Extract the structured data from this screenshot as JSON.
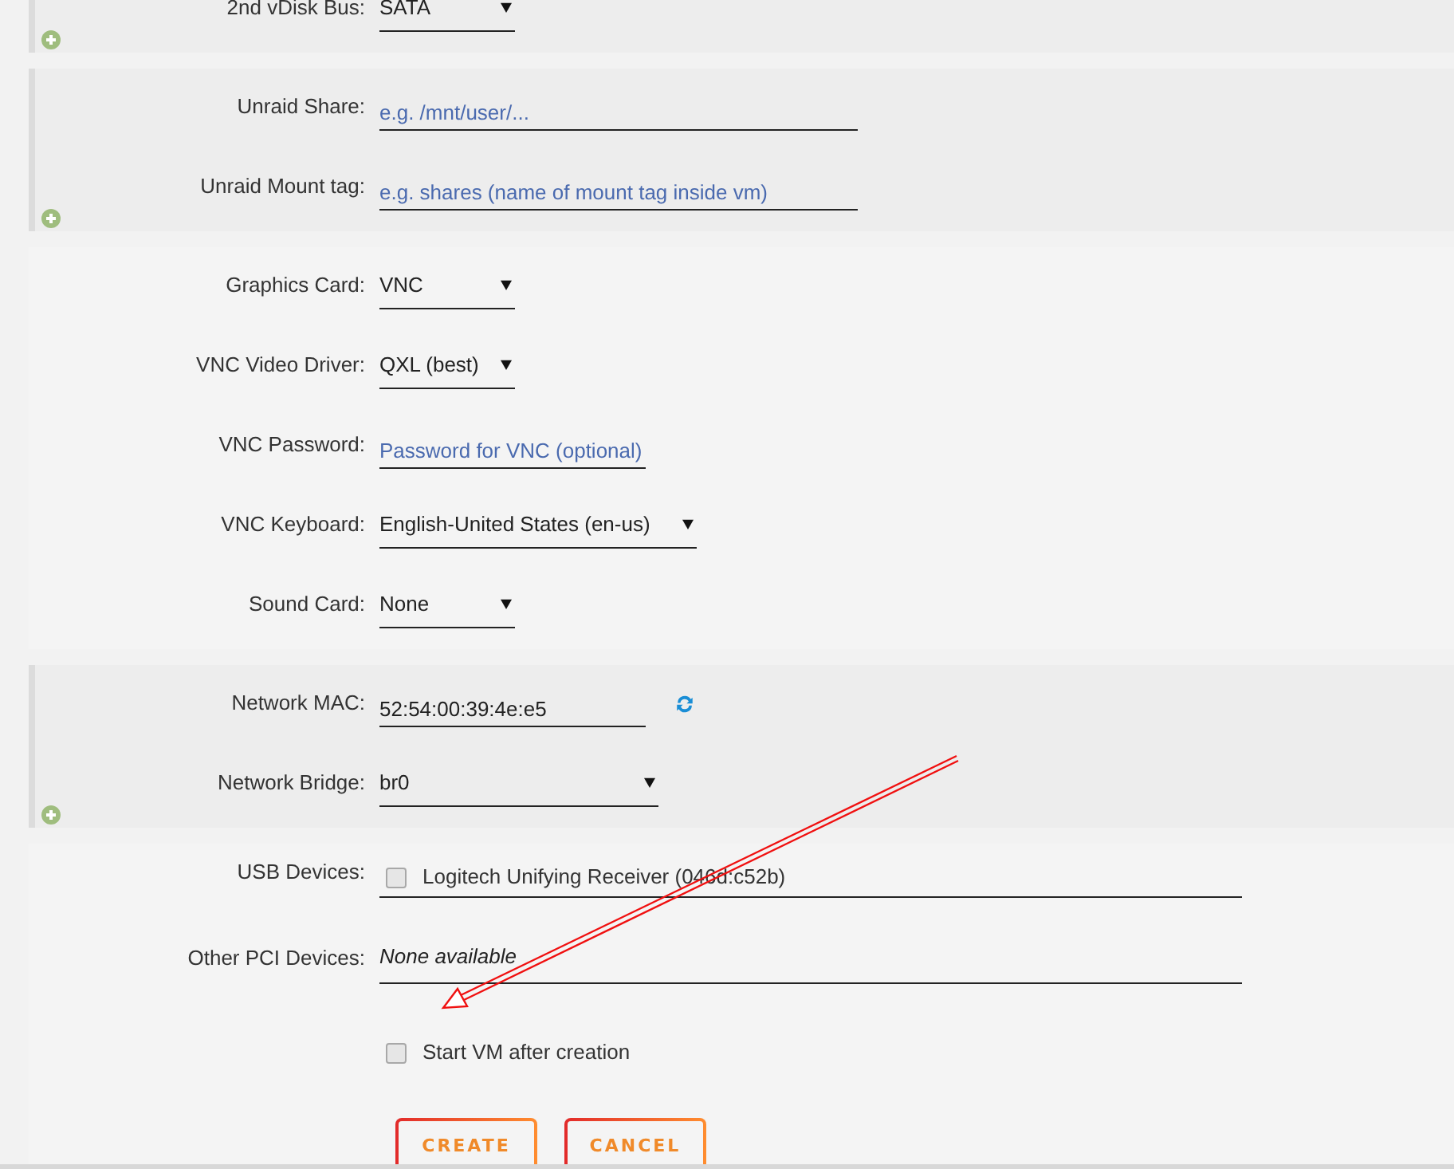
{
  "sections": [
    {
      "expandable": true,
      "rows": [
        {
          "kind": "select",
          "label": "2nd vDisk Bus:",
          "value": "SATA"
        }
      ]
    },
    {
      "expandable": true,
      "rows": [
        {
          "kind": "input",
          "label": "Unraid Share:",
          "placeholder": "e.g. /mnt/user/..."
        },
        {
          "kind": "input",
          "label": "Unraid Mount tag:",
          "placeholder": "e.g. shares (name of mount tag inside vm)"
        }
      ]
    },
    {
      "expandable": false,
      "rows": [
        {
          "kind": "select",
          "label": "Graphics Card:",
          "value": "VNC"
        },
        {
          "kind": "select",
          "label": "VNC Video Driver:",
          "value": "QXL (best)"
        },
        {
          "kind": "input",
          "label": "VNC Password:",
          "placeholder": "Password for VNC (optional)"
        },
        {
          "kind": "select",
          "label": "VNC Keyboard:",
          "value": "English-United States (en-us)"
        },
        {
          "kind": "select",
          "label": "Sound Card:",
          "value": "None"
        }
      ]
    },
    {
      "expandable": true,
      "rows": [
        {
          "kind": "input",
          "label": "Network MAC:",
          "value": "52:54:00:39:4e:e5",
          "refresh": true
        },
        {
          "kind": "select",
          "label": "Network Bridge:",
          "value": "br0"
        }
      ]
    },
    {
      "expandable": false,
      "rows": [
        {
          "kind": "checklist",
          "label": "USB Devices:",
          "options": [
            {
              "label": "Logitech Unifying Receiver (046d:c52b)",
              "checked": false
            }
          ]
        },
        {
          "kind": "note",
          "label": "Other PCI Devices:",
          "text": "None available"
        },
        {
          "kind": "checkbox",
          "label": "Start VM after creation",
          "checked": false
        }
      ],
      "buttons": [
        "CREATE",
        "CANCEL"
      ]
    }
  ]
}
